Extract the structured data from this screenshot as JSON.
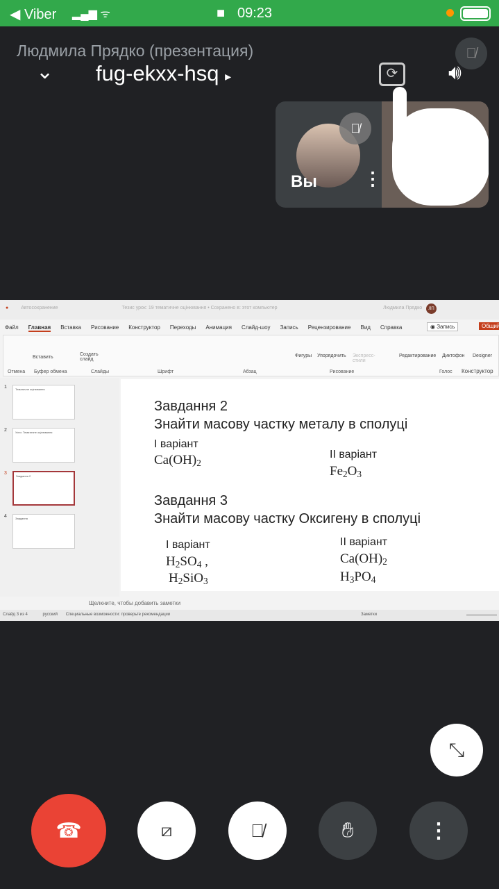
{
  "status": {
    "back_app": "Viber",
    "time": "09:23"
  },
  "meeting": {
    "presenter": "Людмила Прядко (презентация)",
    "code": "fug-ekxx-hsq",
    "self_label": "Вы"
  },
  "ppt": {
    "autosave": "Автосохранение",
    "doc_title": "Тезис урок: 19 тематичне оцінювання • Сохранено в: этот компьютер",
    "user": "Людмила Прядко",
    "user_initials": "ЛП",
    "menu": [
      "Файл",
      "Главная",
      "Вставка",
      "Рисование",
      "Конструктор",
      "Переходы",
      "Анимация",
      "Слайд-шоу",
      "Запись",
      "Рецензирование",
      "Вид",
      "Справка"
    ],
    "record_btn": "Запись",
    "share_btn": "Общий доступ",
    "ribbon": {
      "paste": "Вставить",
      "new_slide": "Создать слайд",
      "shapes": "Фигуры",
      "arrange": "Упорядочить",
      "quick_styles": "Экспресс-стили",
      "editing": "Редактирование",
      "dictate": "Диктофон",
      "designer": "Designer"
    },
    "groups": [
      "Отмена",
      "Буфер обмена",
      "Слайды",
      "Шрифт",
      "Абзац",
      "Рисование",
      "Голос",
      "Конструктор"
    ],
    "thumbs": [
      {
        "n": "1",
        "text": "Тематичне оцінювання"
      },
      {
        "n": "2",
        "text": "Усно: Тематичне оцінювання"
      },
      {
        "n": "3",
        "text": "Завдання 2"
      },
      {
        "n": "4",
        "text": "Завдання"
      }
    ],
    "slide": {
      "t2": "Завдання 2",
      "t2q": "Знайти масову частку металу в сполуці",
      "v1": "I варіант",
      "v2": "II варіант",
      "t3": "Завдання 3",
      "t3q": "Знайти масову частку Оксигену в сполуці"
    },
    "notes": "Щелкните, чтобы добавить заметки",
    "statusbar": {
      "slide": "Слайд 3 из 4",
      "lang": "русский",
      "access": "Специальные возможности: проверьте рекомендации",
      "notes": "Заметки"
    }
  }
}
